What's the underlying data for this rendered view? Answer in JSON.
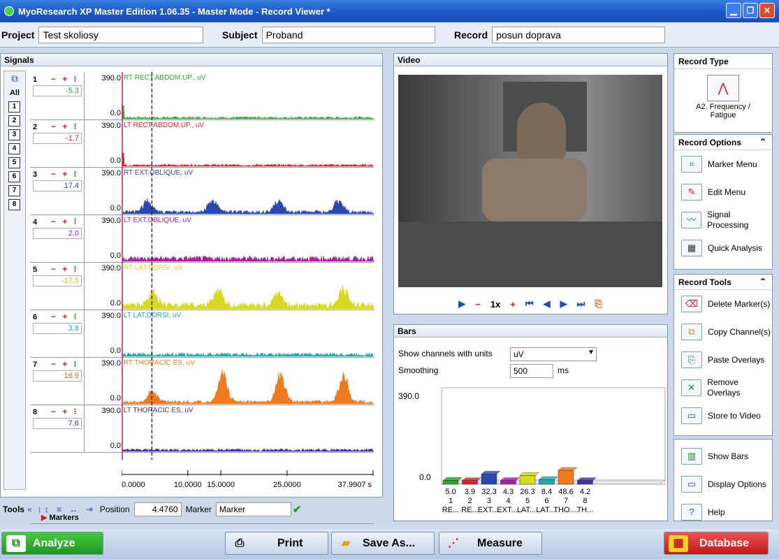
{
  "window": {
    "title": "MyoResearch XP Master Edition 1.06.35 - Master Mode - Record Viewer *"
  },
  "info": {
    "project_label": "Project",
    "project_value": "Test skoliosy",
    "subject_label": "Subject",
    "subject_value": "Proband",
    "record_label": "Record",
    "record_value": "posun doprava"
  },
  "signals": {
    "title": "Signals",
    "all_label": "All",
    "channel_buttons": [
      "1",
      "2",
      "3",
      "4",
      "5",
      "6",
      "7",
      "8"
    ],
    "channels": [
      {
        "num": "1",
        "value": "-5.3",
        "max": "390.0",
        "min": "0.0",
        "name": "RT RECT.ABDOM.UP., uV",
        "color": "#2aa82a",
        "value_color": "#2aa82a",
        "amp": 0.05,
        "peaks": []
      },
      {
        "num": "2",
        "value": "-1.7",
        "max": "390.0",
        "min": "0.0",
        "name": "LT RECT.ABDOM.UP., uV",
        "color": "#d8262e",
        "value_color": "#d8262e",
        "amp": 0.05,
        "peaks": []
      },
      {
        "num": "3",
        "value": "17.4",
        "max": "390.0",
        "min": "0.0",
        "name": "RT EXT.OBLIQUE, uV",
        "color": "#2a48b0",
        "value_color": "#2a48b0",
        "amp": 0.08,
        "peaks": [
          [
            0.1,
            0.3
          ],
          [
            0.36,
            0.35
          ],
          [
            0.62,
            0.3
          ],
          [
            0.86,
            0.3
          ]
        ]
      },
      {
        "num": "4",
        "value": "2.0",
        "max": "390.0",
        "min": "0.0",
        "name": "LT EXT.OBLIQUE, uV",
        "color": "#b01aa8",
        "value_color": "#b01aa8",
        "amp": 0.12,
        "peaks": []
      },
      {
        "num": "5",
        "value": "-17.5",
        "max": "390.0",
        "min": "0.0",
        "name": "RT LAT.DORSI, uV",
        "color": "#d8d820",
        "value_color": "#c8c020",
        "amp": 0.15,
        "peaks": [
          [
            0.12,
            0.35
          ],
          [
            0.38,
            0.4
          ],
          [
            0.62,
            0.35
          ],
          [
            0.88,
            0.45
          ]
        ]
      },
      {
        "num": "6",
        "value": "3.8",
        "max": "390.0",
        "min": "0.0",
        "name": "LT LAT.DORSI, uV",
        "color": "#20a8b0",
        "value_color": "#20a8b0",
        "amp": 0.08,
        "peaks": []
      },
      {
        "num": "7",
        "value": "16.9",
        "max": "390.0",
        "min": "0.0",
        "name": "RT THORACIC ES, uV",
        "color": "#f07a20",
        "value_color": "#e06a10",
        "amp": 0.08,
        "peaks": [
          [
            0.12,
            0.3
          ],
          [
            0.4,
            0.78
          ],
          [
            0.63,
            0.72
          ],
          [
            0.88,
            0.72
          ]
        ]
      },
      {
        "num": "8",
        "value": "7.6",
        "max": "390.0",
        "min": "0.0",
        "name": "LT THORACIC ES, uV",
        "color": "#4030a8",
        "value_color": "#4030a8",
        "amp": 0.06,
        "peaks": []
      }
    ],
    "markers_label": "Markers",
    "time_ticks": [
      {
        "t": 0,
        "label": "0.0000"
      },
      {
        "t": 10,
        "label": "10.0000"
      },
      {
        "t": 15,
        "label": "15.0000"
      },
      {
        "t": 25,
        "label": "25.0000"
      },
      {
        "t": 37.9907,
        "label": "37.9907 s"
      }
    ]
  },
  "tools": {
    "label": "Tools",
    "position_label": "Position",
    "position_value": "4.4760",
    "marker_label": "Marker",
    "marker_value": "Marker"
  },
  "video": {
    "title": "Video",
    "speed": "1x"
  },
  "bars": {
    "title": "Bars",
    "show_label": "Show channels with units",
    "units_value": "uV",
    "smoothing_label": "Smoothing",
    "smoothing_value": "500",
    "smoothing_unit": "ms",
    "ymax": "390.0",
    "ymin": "0.0",
    "chart_data": {
      "type": "bar",
      "categories": [
        "1",
        "2",
        "3",
        "4",
        "5",
        "6",
        "7",
        "8"
      ],
      "labels": [
        "RE...",
        "RE...",
        "EXT....",
        "EXT....",
        "LAT....",
        "LAT....",
        "THO....",
        "TH..."
      ],
      "values": [
        5.0,
        3.9,
        32.3,
        4.3,
        26.3,
        8.4,
        48.6,
        4.2
      ],
      "value_labels": [
        "5.0",
        "3.9",
        "32.3",
        "4.3",
        "26.3",
        "8.4",
        "48.6",
        "4.2"
      ],
      "ylim": [
        0,
        390
      ],
      "colors": [
        "#2aa82a",
        "#d8262e",
        "#2a48b0",
        "#b01aa8",
        "#d8d820",
        "#20a8b0",
        "#f07a20",
        "#4030a8"
      ]
    }
  },
  "sidebar": {
    "record_type": {
      "title": "Record Type",
      "item": "A2. Frequency / Fatigue"
    },
    "record_options": {
      "title": "Record Options",
      "items": [
        "Marker Menu",
        "Edit Menu",
        "Signal Processing",
        "Quick Analysis"
      ]
    },
    "record_tools": {
      "title": "Record Tools",
      "items": [
        "Delete Marker(s)",
        "Copy Channel(s)",
        "Paste Overlays",
        "Remove Overlays",
        "Store to Video"
      ]
    },
    "bottom": {
      "items": [
        "Show Bars",
        "Display Options",
        "Help"
      ]
    }
  },
  "bottombar": {
    "analyze": "Analyze",
    "print": "Print",
    "save_as": "Save As...",
    "measure": "Measure",
    "database": "Database"
  }
}
